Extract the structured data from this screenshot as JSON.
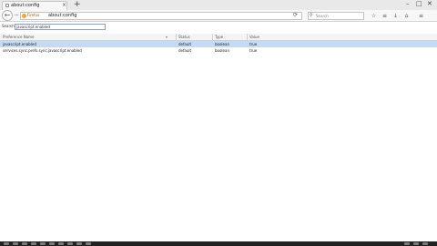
{
  "tab": {
    "title": "about:config",
    "close": "×"
  },
  "new_tab": "+",
  "window_controls": {
    "minimize": "–",
    "maximize": "□",
    "close": "✕"
  },
  "nav": {
    "back": "←",
    "forward": "→",
    "reload": "⟳"
  },
  "urlbar": {
    "identity_label": "Firefox",
    "identity_icon": "firefox-icon",
    "value": "about:config"
  },
  "searchbar": {
    "glyph": "⚲",
    "placeholder": "Search"
  },
  "toolbar": {
    "star": "☆",
    "library": "≡",
    "download": "↓",
    "home": "⌂",
    "menu": "≡"
  },
  "filter": {
    "label": "Search:",
    "value": "javascript.enabled"
  },
  "table": {
    "headers": [
      "Preference Name",
      "Status",
      "Type",
      "Value"
    ],
    "rows": [
      {
        "name": "javascript.enabled",
        "status": "default",
        "type": "boolean",
        "value": "true",
        "selected": true
      },
      {
        "name": "services.sync.prefs.sync.javascript.enabled",
        "status": "default",
        "type": "boolean",
        "value": "true",
        "selected": false
      }
    ]
  },
  "colors": {
    "selection": "#c5dbf5",
    "identity": "#f2a33a",
    "taskbar": "#222222"
  }
}
